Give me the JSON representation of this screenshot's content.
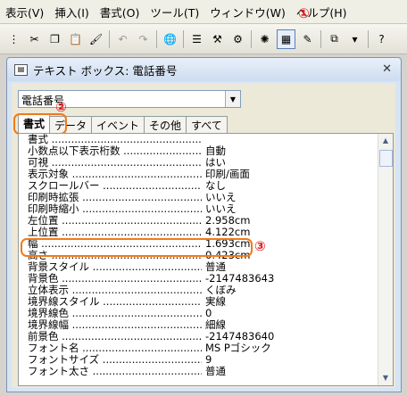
{
  "menubar": {
    "items": [
      "表示(V)",
      "挿入(I)",
      "書式(O)",
      "ツール(T)",
      "ウィンドウ(W)",
      "ヘルプ(H)"
    ]
  },
  "toolbar": {
    "icons": [
      "hide-ducks-icon",
      "cut-icon",
      "copy-icon",
      "paste-icon",
      "format-painter-icon",
      "undo-icon",
      "redo-icon",
      "hyperlink-icon",
      "field-list-icon",
      "build-icon",
      "code-icon",
      "properties-icon",
      "autoformat-icon",
      "new-object-icon",
      "help-icon"
    ]
  },
  "annotations": {
    "one": "①",
    "two": "②",
    "three": "③"
  },
  "window": {
    "title": "テキスト ボックス: 電話番号"
  },
  "combo": {
    "value": "電話番号"
  },
  "tabs": [
    "書式",
    "データ",
    "イベント",
    "その他",
    "すべて"
  ],
  "properties": [
    {
      "name": "書式",
      "value": ""
    },
    {
      "name": "小数点以下表示桁数",
      "value": "自動"
    },
    {
      "name": "可視",
      "value": "はい"
    },
    {
      "name": "表示対象",
      "value": "印刷/画面"
    },
    {
      "name": "スクロールバー",
      "value": "なし"
    },
    {
      "name": "印刷時拡張",
      "value": "いいえ"
    },
    {
      "name": "印刷時縮小",
      "value": "いいえ"
    },
    {
      "name": "左位置",
      "value": "2.958cm"
    },
    {
      "name": "上位置",
      "value": "4.122cm"
    },
    {
      "name": "幅",
      "value": "1.693cm"
    },
    {
      "name": "高さ",
      "value": "0.423cm"
    },
    {
      "name": "背景スタイル",
      "value": "普通"
    },
    {
      "name": "背景色",
      "value": "-2147483643"
    },
    {
      "name": "立体表示",
      "value": "くぼみ"
    },
    {
      "name": "境界線スタイル",
      "value": "実線"
    },
    {
      "name": "境界線色",
      "value": "0"
    },
    {
      "name": "境界線幅",
      "value": "細線"
    },
    {
      "name": "前景色",
      "value": "-2147483640"
    },
    {
      "name": "フォント名",
      "value": "MS Pゴシック"
    },
    {
      "name": "フォントサイズ",
      "value": "9"
    },
    {
      "name": "フォント太さ",
      "value": "普通"
    }
  ],
  "colors": {
    "highlight": "#f07a1a",
    "annotation": "#e02020"
  }
}
